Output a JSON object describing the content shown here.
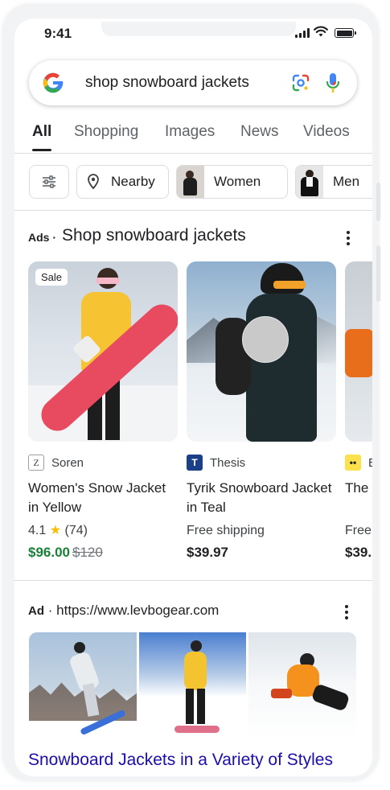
{
  "status_bar": {
    "time": "9:41"
  },
  "search": {
    "query": "shop snowboard jackets",
    "logo_icon": "google-g-icon",
    "lens_icon": "google-lens-icon",
    "mic_icon": "microphone-icon"
  },
  "tabs": [
    {
      "label": "All",
      "active": true
    },
    {
      "label": "Shopping"
    },
    {
      "label": "Images"
    },
    {
      "label": "News"
    },
    {
      "label": "Videos"
    }
  ],
  "chips": [
    {
      "label": "",
      "icon": "filter-sliders-icon"
    },
    {
      "label": "Nearby",
      "icon": "location-pin-icon"
    },
    {
      "label": "Women"
    },
    {
      "label": "Men"
    }
  ],
  "ads": {
    "label": "Ads",
    "separator": "·",
    "title": "Shop snowboard jackets",
    "products": [
      {
        "badge": "Sale",
        "merchant": "Soren",
        "merchant_logo": "Z",
        "name": "Women's Snow Jacket in Yellow",
        "rating": "4.1",
        "reviews": "(74)",
        "price": "$96.00",
        "old_price": "$120"
      },
      {
        "merchant": "Thesis",
        "merchant_logo": "T",
        "name": "Tyrik Snowboard Jacket in Teal",
        "shipping": "Free shipping",
        "price": "$39.97"
      },
      {
        "merchant": "E",
        "name": "The Jack",
        "shipping": "Free",
        "price": "$39."
      }
    ]
  },
  "ad2": {
    "label": "Ad",
    "separator": "·",
    "url": "https://www.levbogear.com",
    "link_title": "Snowboard Jackets in a Variety of Styles"
  },
  "colors": {
    "link": "#1a0dab",
    "sale_price": "#188038",
    "star": "#fbbc04"
  }
}
